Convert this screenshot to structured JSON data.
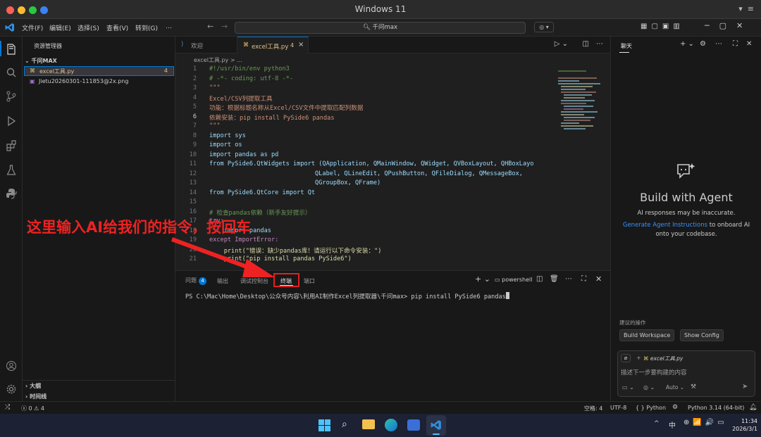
{
  "window": {
    "title": "Windows 11"
  },
  "menu": [
    "文件(F)",
    "编辑(E)",
    "选择(S)",
    "查看(V)",
    "转到(G)",
    "…"
  ],
  "search": {
    "text": "千问max"
  },
  "sidebar": {
    "title": "资源管理器",
    "folder": "千问MAX",
    "files": [
      {
        "name": "excel工具.py",
        "badge": "4"
      },
      {
        "name": "Jietu20260301-111853@2x.png",
        "badge": ""
      }
    ],
    "outline": "大纲",
    "timeline": "时间线"
  },
  "tabs": [
    {
      "label": "欢迎"
    },
    {
      "label": "excel工具.py",
      "badge": "4"
    }
  ],
  "breadcrumb": "excel工具.py > ...",
  "code": [
    {
      "n": "1",
      "t": "#!/usr/bin/env python3",
      "c": "#6a9955"
    },
    {
      "n": "2",
      "t": "# -*- coding: utf-8 -*-",
      "c": "#6a9955"
    },
    {
      "n": "3",
      "t": "\"\"\"",
      "c": "#ce9178"
    },
    {
      "n": "4",
      "t": "Excel/CSV列提取工具",
      "c": "#ce9178"
    },
    {
      "n": "5",
      "t": "功能：根据标题名称从Excel/CSV文件中提取匹配列数据",
      "c": "#ce9178"
    },
    {
      "n": "6",
      "t": "依赖安装：pip install PySide6 pandas",
      "c": "#ce9178"
    },
    {
      "n": "7",
      "t": "\"\"\"",
      "c": "#ce9178"
    },
    {
      "n": "8",
      "t": "import sys",
      "c": "#9cdcfe"
    },
    {
      "n": "9",
      "t": "import os",
      "c": "#9cdcfe"
    },
    {
      "n": "10",
      "t": "import pandas as pd",
      "c": "#9cdcfe"
    },
    {
      "n": "11",
      "t": "from PySide6.QtWidgets import (QApplication, QMainWindow, QWidget, QVBoxLayout, QHBoxLayo",
      "c": "#9cdcfe"
    },
    {
      "n": "12",
      "t": "                             QLabel, QLineEdit, QPushButton, QFileDialog, QMessageBox,",
      "c": "#9cdcfe"
    },
    {
      "n": "13",
      "t": "                             QGroupBox, QFrame)",
      "c": "#9cdcfe"
    },
    {
      "n": "14",
      "t": "from PySide6.QtCore import Qt",
      "c": "#9cdcfe"
    },
    {
      "n": "15",
      "t": "",
      "c": "#cccccc"
    },
    {
      "n": "16",
      "t": "# 检查pandas依赖（新手友好提示）",
      "c": "#6a9955"
    },
    {
      "n": "17",
      "t": "try:",
      "c": "#c586c0"
    },
    {
      "n": "18",
      "t": "    import pandas",
      "c": "#9cdcfe"
    },
    {
      "n": "19",
      "t": "except ImportError:",
      "c": "#c586c0"
    },
    {
      "n": "20",
      "t": "    print(\"错误：缺少pandas库！请运行以下命令安装：\")",
      "c": "#dcdcaa"
    },
    {
      "n": "21",
      "t": "    print(\"pip install pandas PySide6\")",
      "c": "#dcdcaa"
    }
  ],
  "panel": {
    "tabs": [
      {
        "label": "问题",
        "badge": "4"
      },
      {
        "label": "输出"
      },
      {
        "label": "调试控制台"
      },
      {
        "label": "终端"
      },
      {
        "label": "端口"
      }
    ],
    "shell": "powershell",
    "terminal_line": "PS C:\\Mac\\Home\\Desktop\\公众号内容\\利用AI制作Excel列提取器\\千问max> pip install PySide6 pandas"
  },
  "annotation": "这里输入AI给我们的指令，按回车",
  "chat": {
    "tab": "聊天",
    "heading": "Build with Agent",
    "note": "AI responses may be inaccurate.",
    "link": "Generate Agent Instructions",
    "link_rest": " to onboard AI",
    "link_rest2": "onto your codebase.",
    "suggest_label": "建议的操作",
    "suggest": [
      "Build Workspace",
      "Show Config"
    ],
    "file_chip": "excel工具.py",
    "placeholder": "描述下一步要构建的内容",
    "mode": "Auto"
  },
  "status": {
    "errors": "0",
    "warnings": "4",
    "spaces": "空格: 4",
    "encoding": "UTF-8",
    "lang_braces": "{ }",
    "lang": "Python",
    "interpreter": "Python 3.14 (64-bit)"
  },
  "taskbar": {
    "ime": "中",
    "time": "11:34",
    "date": "2026/3/1"
  },
  "colors": {
    "accent": "#0078d4",
    "annotation": "#ee2222"
  }
}
